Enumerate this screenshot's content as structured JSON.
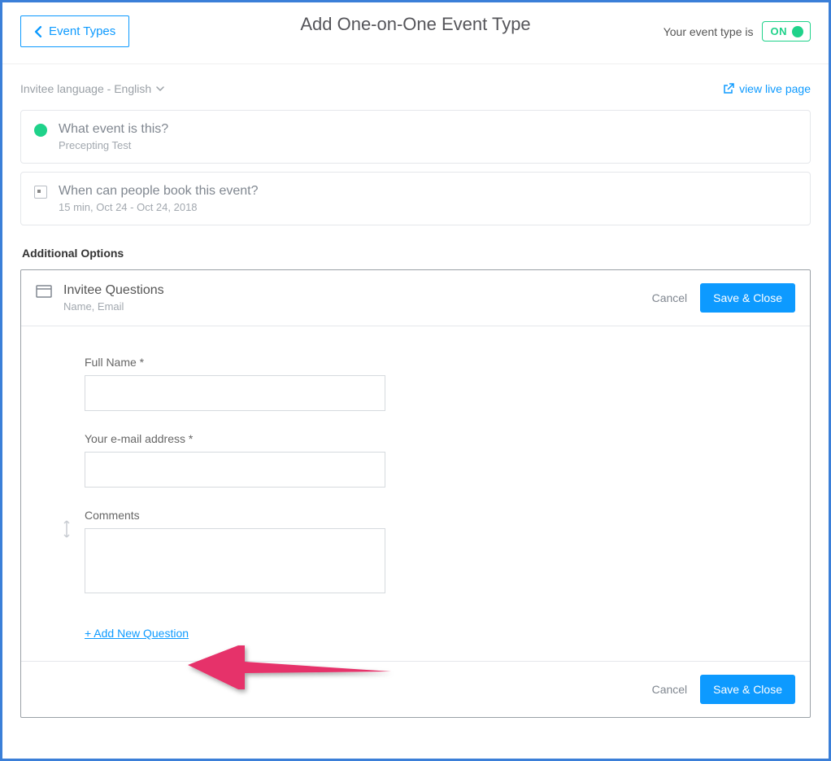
{
  "nav": {
    "back_label": "Event Types"
  },
  "header": {
    "title": "Add One-on-One Event Type",
    "status_prefix": "Your event type is",
    "toggle_label": "ON"
  },
  "subheader": {
    "language_label": "Invitee language - English",
    "live_label": "view live page"
  },
  "sections": {
    "what": {
      "title": "What event is this?",
      "sub": "Precepting Test"
    },
    "when": {
      "title": "When can people book this event?",
      "sub": "15 min, Oct 24 - Oct 24, 2018"
    }
  },
  "additional": {
    "label": "Additional Options",
    "questions": {
      "title": "Invitee Questions",
      "sub": "Name, Email",
      "cancel": "Cancel",
      "save": "Save & Close",
      "fields": {
        "full_name": "Full Name *",
        "email": "Your e-mail address *",
        "comments": "Comments"
      },
      "add_new": "+ Add New Question"
    }
  }
}
